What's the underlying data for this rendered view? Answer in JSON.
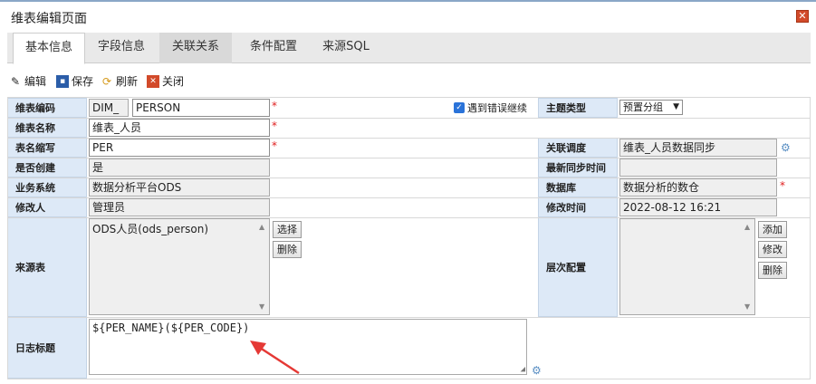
{
  "window": {
    "title": "维表编辑页面"
  },
  "tabs": [
    "基本信息",
    "字段信息",
    "关联关系",
    "条件配置",
    "来源SQL"
  ],
  "toolbar": {
    "edit": "编辑",
    "save": "保存",
    "refresh": "刷新",
    "close": "关闭"
  },
  "form": {
    "code_label": "维表编码",
    "code_prefix": "DIM_",
    "code_value": "PERSON",
    "continue_on_error": "遇到错误继续",
    "continue_on_error_checked": true,
    "theme_type_label": "主题类型",
    "theme_type_value": "预置分组",
    "name_label": "维表名称",
    "name_value": "维表_人员",
    "abbr_label": "表名缩写",
    "abbr_value": "PER",
    "schedule_label": "关联调度",
    "schedule_value": "维表_人员数据同步",
    "created_label": "是否创建",
    "created_value": "是",
    "sync_time_label": "最新同步时间",
    "sync_time_value": "",
    "biz_label": "业务系统",
    "biz_value": "数据分析平台ODS",
    "db_label": "数据库",
    "db_value": "数据分析的数仓",
    "modifier_label": "修改人",
    "modifier_value": "管理员",
    "modtime_label": "修改时间",
    "modtime_value": "2022-08-12 16:21",
    "source_label": "来源表",
    "source_items": [
      "ODS人员(ods_person)"
    ],
    "source_select": "选择",
    "source_delete": "删除",
    "level_label": "层次配置",
    "level_add": "添加",
    "level_edit": "修改",
    "level_delete": "删除",
    "log_label": "日志标题",
    "log_value": "${PER_NAME}(${PER_CODE})",
    "required_mark": "*"
  }
}
